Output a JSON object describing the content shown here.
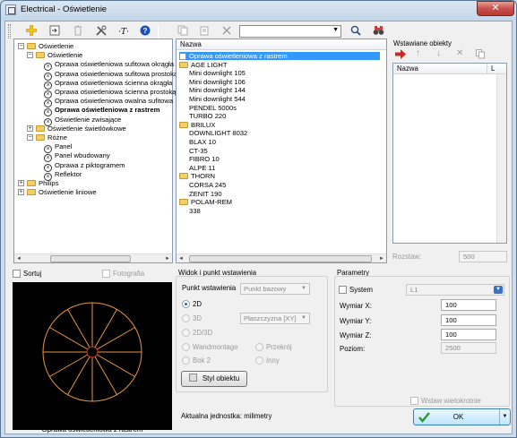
{
  "window": {
    "title": "Electrical - Oświetlenie",
    "close_glyph": "✕"
  },
  "toolbar": {
    "icons": [
      "new-item-icon",
      "import-icon",
      "delete-icon",
      "tools-icon",
      "text-format-icon",
      "help-icon",
      "copy-icon",
      "paste-icon",
      "remove-icon",
      "search-icon",
      "binoculars-icon"
    ],
    "filter_value": ""
  },
  "tree": {
    "items": [
      {
        "label": "Oświetlenie",
        "level": 0,
        "type": "folder",
        "expand": "−"
      },
      {
        "label": "Oświetlenie",
        "level": 1,
        "type": "folder",
        "expand": "−"
      },
      {
        "label": "Oprawa oświetleniowa sufitowa okrągła",
        "level": 2,
        "type": "fixture"
      },
      {
        "label": "Oprawa oświetleniowa sufitowa prostokątna",
        "level": 2,
        "type": "fixture"
      },
      {
        "label": "Oprawa oświetleniowa ścienna okrągła",
        "level": 2,
        "type": "fixture"
      },
      {
        "label": "Oprawa oświetleniowa ścienna prostokątna",
        "level": 2,
        "type": "fixture"
      },
      {
        "label": "Oprawa oświetleniowa owalna sufitowa",
        "level": 2,
        "type": "fixture"
      },
      {
        "label": "Oprawa oświetleniowa z rastrem",
        "level": 2,
        "type": "fixture",
        "bold": true
      },
      {
        "label": "Oświetlenie zwisające",
        "level": 2,
        "type": "fixture"
      },
      {
        "label": "Oświetlenie świetlówkowe",
        "level": 1,
        "type": "folder",
        "expand": "+"
      },
      {
        "label": "Różne",
        "level": 1,
        "type": "folder",
        "expand": "−"
      },
      {
        "label": "Panel",
        "level": 2,
        "type": "fixture"
      },
      {
        "label": "Panel wbudowany",
        "level": 2,
        "type": "fixture"
      },
      {
        "label": "Oprawa z piktogramem",
        "level": 2,
        "type": "fixture"
      },
      {
        "label": "Reflektor",
        "level": 2,
        "type": "fixture"
      },
      {
        "label": "Philips",
        "level": 0,
        "type": "folder",
        "expand": "+"
      },
      {
        "label": "Oświetlenie liniowe",
        "level": 0,
        "type": "folder",
        "expand": "+"
      }
    ]
  },
  "list": {
    "header": "Nazwa",
    "rows": [
      {
        "label": "Oprawa oświetleniowa z rastrem",
        "kind": "selected"
      },
      {
        "label": "AGE LIGHT",
        "kind": "folder"
      },
      {
        "label": "Mini downlight 105",
        "kind": "item"
      },
      {
        "label": "Mini downlight 106",
        "kind": "item"
      },
      {
        "label": "Mini downlight 144",
        "kind": "item"
      },
      {
        "label": "Mini downlight 544",
        "kind": "item"
      },
      {
        "label": "PENDEL 5000s",
        "kind": "item"
      },
      {
        "label": "TURBO 220",
        "kind": "item"
      },
      {
        "label": "BRILUX",
        "kind": "folder"
      },
      {
        "label": "DOWNLIGHT 8032",
        "kind": "item"
      },
      {
        "label": "BLAX 10",
        "kind": "item"
      },
      {
        "label": "CT-35",
        "kind": "item"
      },
      {
        "label": "FIBRO 10",
        "kind": "item"
      },
      {
        "label": "ALPE 11",
        "kind": "item"
      },
      {
        "label": "THORN",
        "kind": "folder"
      },
      {
        "label": "CORSA 245",
        "kind": "item"
      },
      {
        "label": "ZENIT 190",
        "kind": "item"
      },
      {
        "label": "POLAM-REM",
        "kind": "folder"
      },
      {
        "label": "338",
        "kind": "item"
      }
    ]
  },
  "inserted": {
    "title": "Wstawiane obiekty",
    "col_name": "Nazwa",
    "col_l": "L",
    "spacing_label": "Rozstaw:",
    "spacing_value": "500"
  },
  "preview": {
    "sort_label": "Sortuj",
    "photo_label": "Fotografia",
    "caption": "Oprawa oświetleniowa z rastrem"
  },
  "insertion": {
    "group_title": "Widok i punkt wstawienia",
    "point_label": "Punkt wstawienia",
    "point_value": "Punkt bazowy",
    "opt_2d": "2D",
    "opt_3d": "3D",
    "opt_2d3d": "2D/3D",
    "plane_value": "Płaszczyzna [XY]",
    "opt_wandmontage": "Wandmontage",
    "opt_przekroj": "Przekrój",
    "opt_bok2": "Bok 2",
    "opt_inny": "Inny",
    "style_button": "Styl obiektu",
    "unit_text": "Aktualna jednostka: milimetry"
  },
  "params": {
    "group_title": "Parametry",
    "system_label": "System",
    "system_value": "L1",
    "dim_x_label": "Wymiar X:",
    "dim_x": "100",
    "dim_y_label": "Wymiar Y:",
    "dim_y": "100",
    "dim_z_label": "Wymiar Z:",
    "dim_z": "100",
    "level_label": "Poziom:",
    "level": "2500",
    "multi_insert_label": "Wstaw wielokrotnie",
    "ok_label": "OK"
  },
  "colors": {
    "accent": "#3399ff",
    "preview_bg": "#000000",
    "fixture_orange": "#e8963a",
    "fixture_red": "#d83a2a",
    "ok_check": "#2a9a2a",
    "insert_arrow": "#d0281e"
  }
}
